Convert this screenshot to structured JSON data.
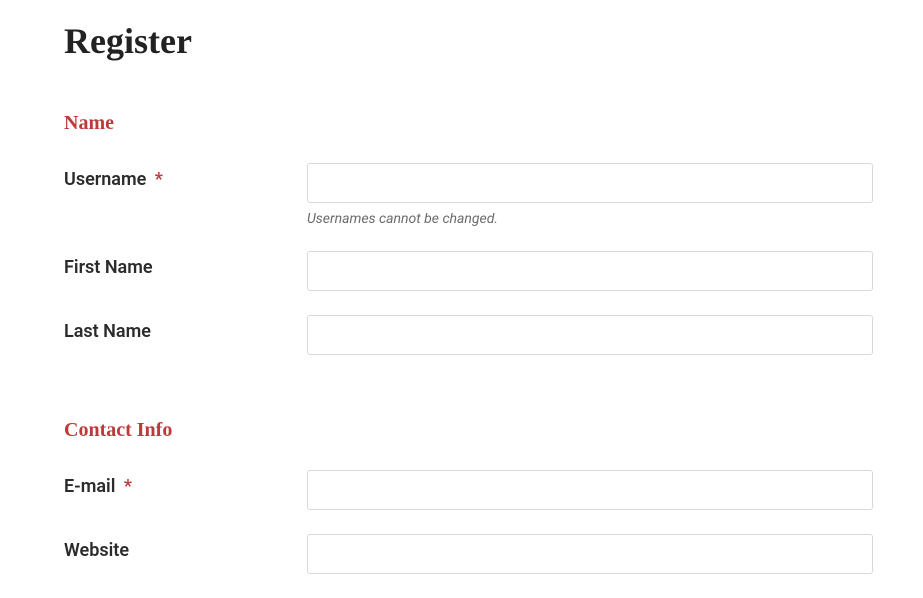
{
  "page_title": "Register",
  "sections": {
    "name": {
      "heading": "Name",
      "fields": {
        "username": {
          "label": "Username",
          "required_mark": "*",
          "hint": "Usernames cannot be changed."
        },
        "first_name": {
          "label": "First Name"
        },
        "last_name": {
          "label": "Last Name"
        }
      }
    },
    "contact": {
      "heading": "Contact Info",
      "fields": {
        "email": {
          "label": "E-mail",
          "required_mark": "*"
        },
        "website": {
          "label": "Website"
        }
      }
    }
  }
}
